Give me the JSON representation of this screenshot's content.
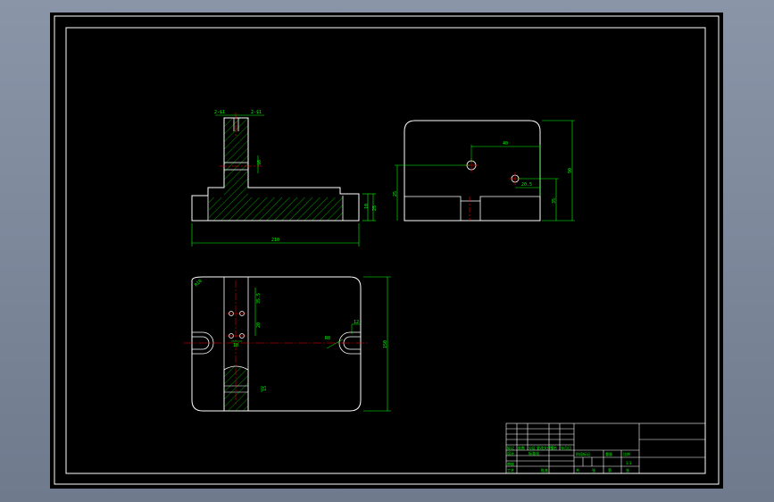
{
  "colors": {
    "background": "#000000",
    "outline": "#ffffff",
    "dimension": "#00ff00",
    "centerline": "#ff0000",
    "hatch": "#00ff00",
    "window": "#7d889b"
  },
  "views": {
    "front": {
      "top_dims": [
        "2-$1",
        "2-$1"
      ],
      "hole_dim": "$6",
      "overall_width": "210",
      "right_heights": [
        "10",
        "25"
      ]
    },
    "side": {
      "hole_spacing": "40",
      "offset": "20.5",
      "left_height": "25",
      "right_height": "35",
      "overall_height": "90"
    },
    "top": {
      "corner_radius": "R10",
      "vertical_dim": "35.5",
      "spacing": "20",
      "hole_x": "18",
      "slot_width": "12",
      "slot_radius": "R8",
      "lower_dim": "15",
      "overall_height": "150"
    }
  },
  "title_block": {
    "labels": [
      "标记",
      "处数",
      "分区",
      "更改文件号",
      "签名",
      "年月日",
      "设计",
      "标准化",
      "审核",
      "工艺",
      "批准",
      "阶段标记",
      "重量",
      "比例",
      "共",
      "张",
      "第",
      "张"
    ],
    "scale": "1:1"
  }
}
